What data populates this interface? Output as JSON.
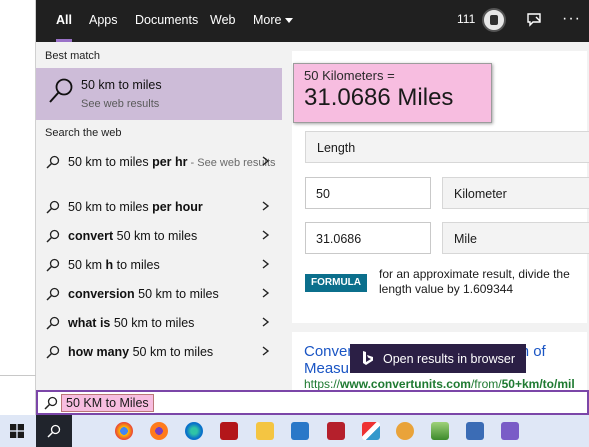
{
  "tabs": [
    {
      "label": "All",
      "active": true
    },
    {
      "label": "Apps"
    },
    {
      "label": "Documents"
    },
    {
      "label": "Web"
    },
    {
      "label": "More"
    }
  ],
  "header": {
    "points": "111",
    "icons": [
      "rewards-medal-icon",
      "feedback-icon",
      "more-options-icon"
    ],
    "more_options": "···"
  },
  "best_match": {
    "section_label": "Best match",
    "title": "50 km to miles",
    "subtitle": "See web results",
    "icon": "search-icon"
  },
  "search_web": {
    "section_label": "Search the web",
    "suggestions": [
      {
        "plain_pre": "50 km to miles ",
        "bold": "per hr",
        "plain_post": "",
        "hint": " - See web results"
      },
      {
        "plain_pre": "50 km to miles ",
        "bold": "per hour",
        "plain_post": ""
      },
      {
        "plain_pre": "",
        "bold": "convert",
        "plain_post": " 50 km to miles"
      },
      {
        "plain_pre": "50 km ",
        "bold": "h",
        "plain_post": " to miles"
      },
      {
        "plain_pre": "",
        "bold": "conversion",
        "plain_post": " 50 km to miles"
      },
      {
        "plain_pre": "",
        "bold": "what is",
        "plain_post": " 50 km to miles"
      },
      {
        "plain_pre": "",
        "bold": "how many",
        "plain_post": " 50 km to miles"
      }
    ]
  },
  "converter": {
    "from_text": "50 Kilometers =",
    "to_text": "31.0686 Miles",
    "category": "Length",
    "input_value": "50",
    "input_unit": "Kilometer",
    "output_value": "31.0686",
    "output_unit": "Mile",
    "formula_badge": "FORMULA",
    "formula_text": "for an approximate result, divide the length value by 1.609344"
  },
  "web_result": {
    "title_line1": "Conver",
    "title_line1_end": "on of",
    "title_line2": "Measurement Units",
    "url_prefix": "https://",
    "url_bold1": "www.convertunits.com",
    "url_mid": "/from/",
    "url_bold2": "50+km/to/mil"
  },
  "open_browser": {
    "label": "Open results in browser",
    "icon": "bing-icon"
  },
  "search_box": {
    "query": "50 KM to Miles",
    "icon": "search-icon"
  },
  "colors": {
    "accent": "#7b46a8",
    "highlight": "#f7bde0",
    "best_match_bg": "#cdbcd8",
    "formula_badge": "#0b6f8c",
    "link": "#1a55c4",
    "url": "#1e7a31"
  },
  "taskbar": {
    "icons": [
      "windows-start-icon",
      "search-icon",
      "chrome-icon",
      "firefox-icon",
      "edge-icon",
      "filezilla-icon",
      "folder-icon",
      "outlook-icon",
      "app-red-icon",
      "paint-icon",
      "mask-icon",
      "photos-icon",
      "app-icon",
      "notepad-icon"
    ]
  }
}
